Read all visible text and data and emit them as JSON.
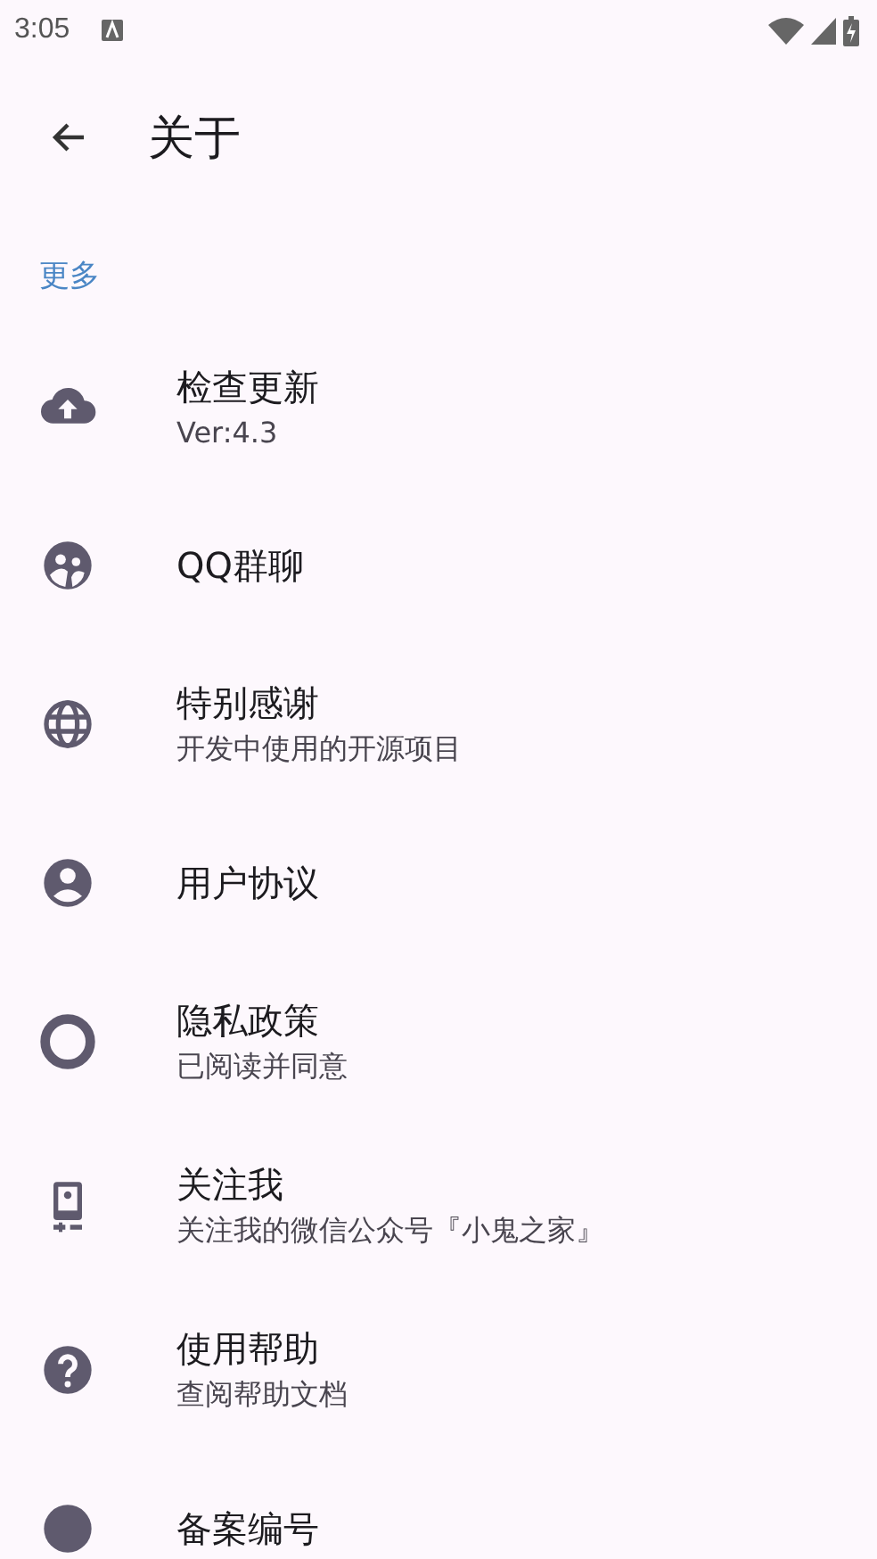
{
  "status_bar": {
    "time": "3:05"
  },
  "app_bar": {
    "title": "关于"
  },
  "section": {
    "title": "更多"
  },
  "items": [
    {
      "title": "检查更新",
      "subtitle": "Ver:4.3"
    },
    {
      "title": "QQ群聊"
    },
    {
      "title": "特别感谢",
      "subtitle": "开发中使用的开源项目"
    },
    {
      "title": "用户协议"
    },
    {
      "title": "隐私政策",
      "subtitle": "已阅读并同意"
    },
    {
      "title": "关注我",
      "subtitle": "关注我的微信公众号『小鬼之家』"
    },
    {
      "title": "使用帮助",
      "subtitle": "查阅帮助文档"
    },
    {
      "title": "备案编号"
    }
  ]
}
